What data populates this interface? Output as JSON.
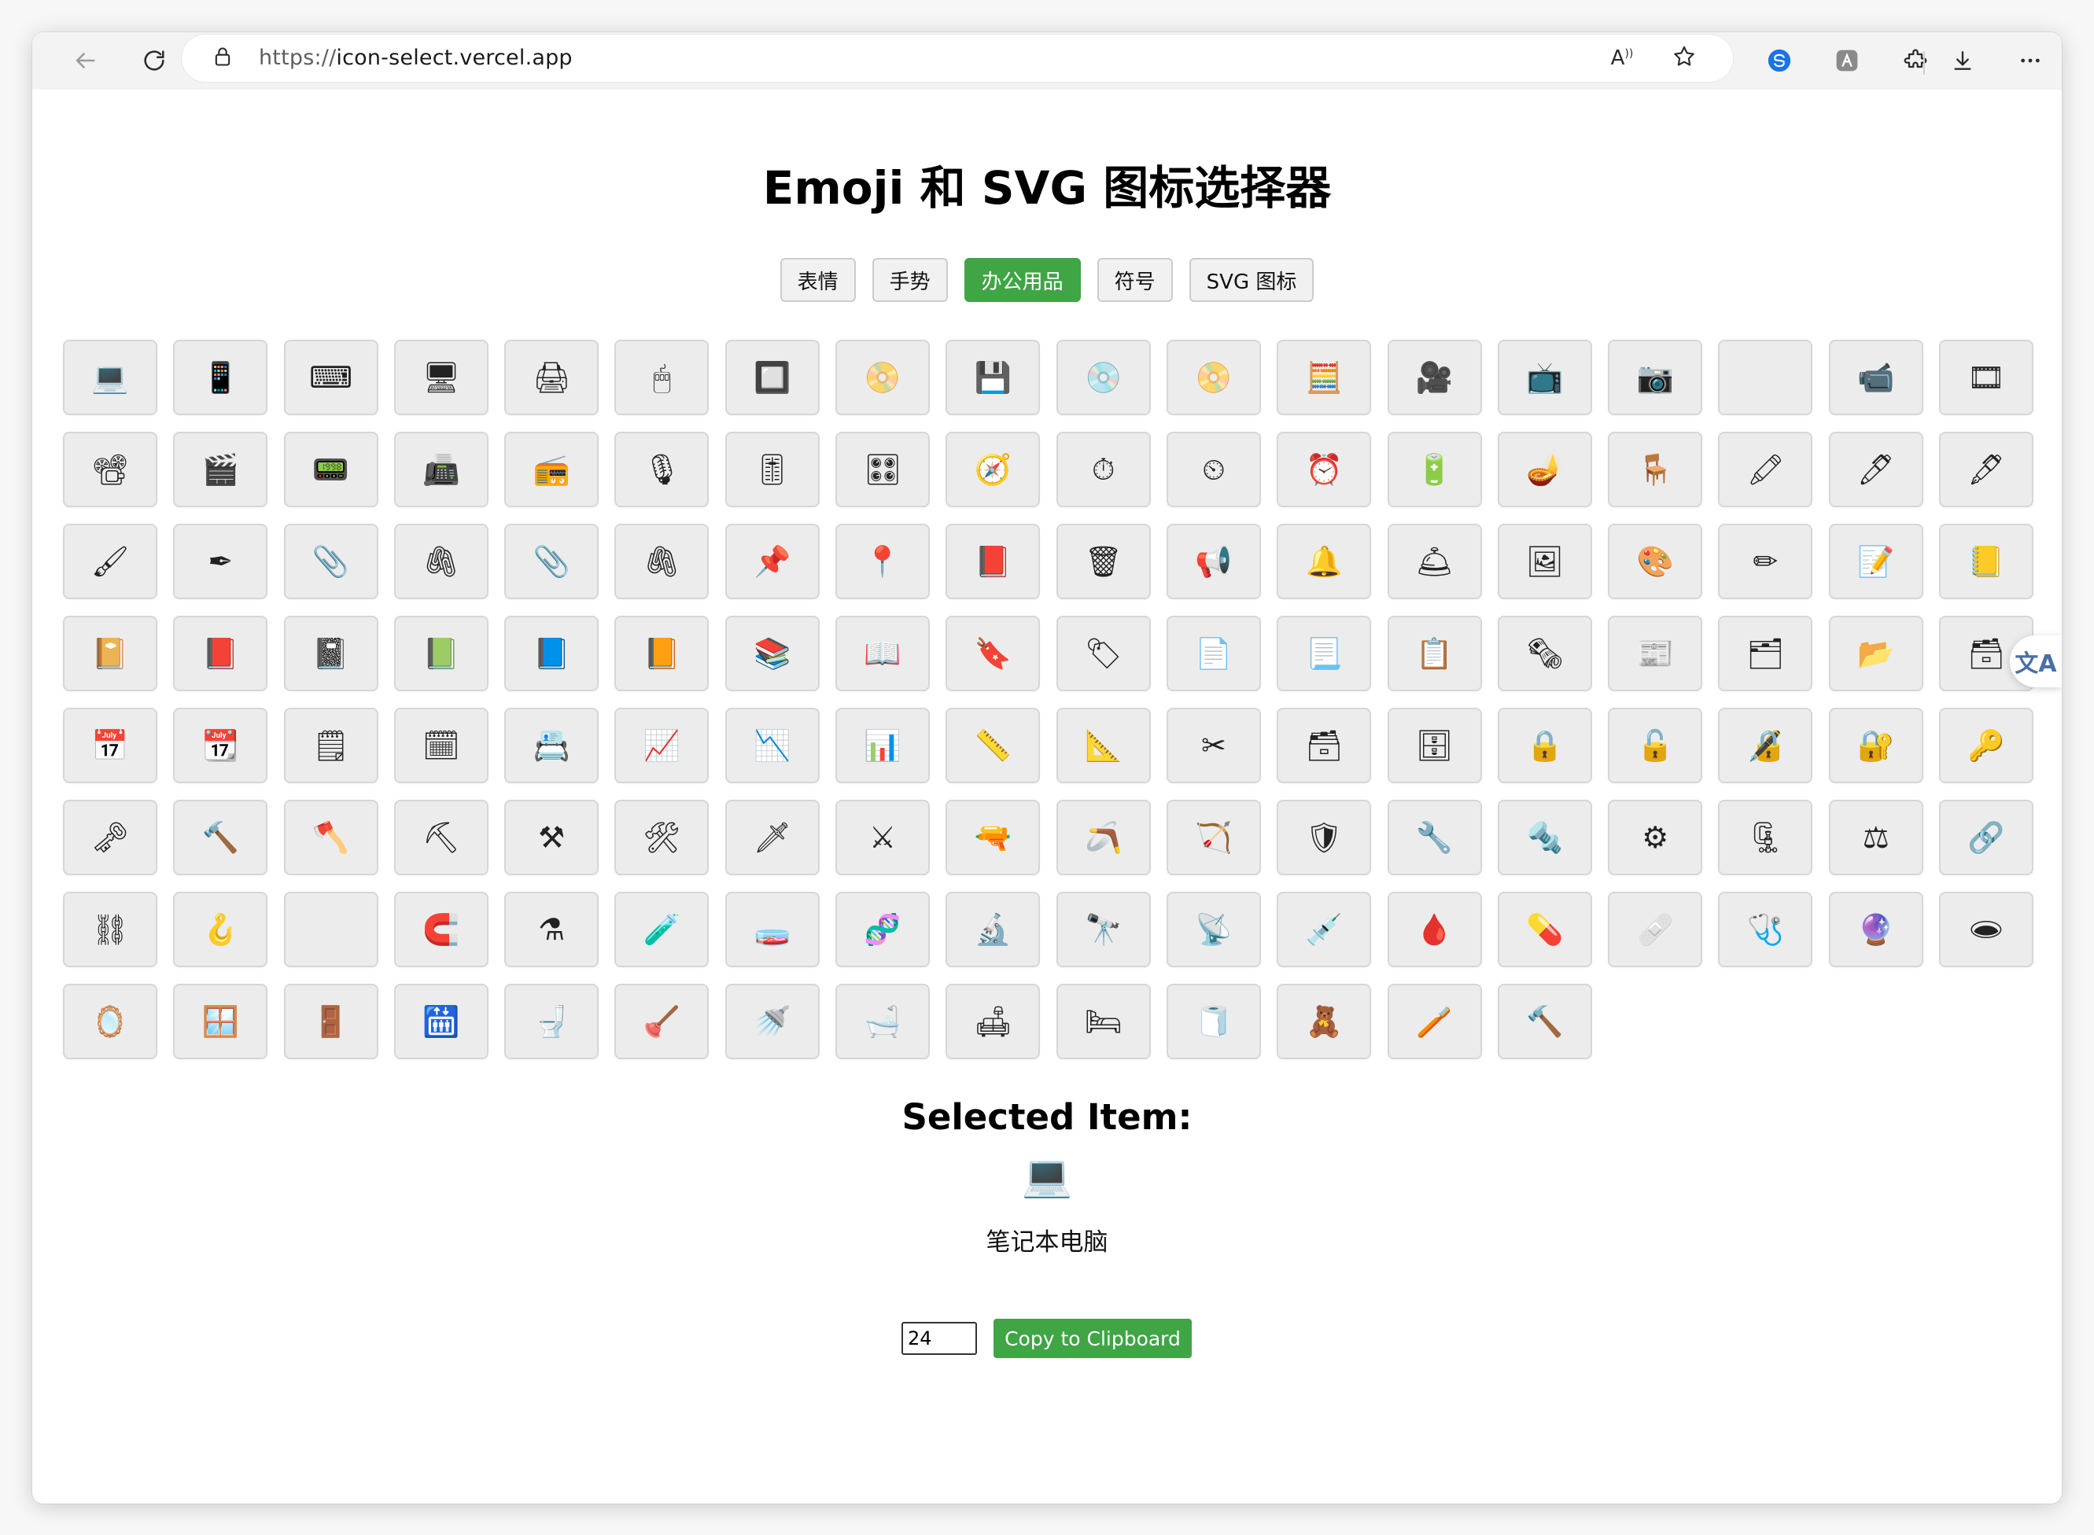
{
  "browser": {
    "url_scheme": "https://",
    "url_host": "icon-select.vercel.app",
    "icons": {
      "back": "arrow-left-icon",
      "reload": "reload-icon",
      "site_info": "lock-icon",
      "read_aloud": "read-aloud-icon",
      "favorite": "star-icon",
      "ext1": "extension-blue-icon",
      "ext2": "extension-gray-icon",
      "extensions": "puzzle-icon",
      "downloads": "download-icon",
      "menu": "more-icon"
    }
  },
  "page": {
    "title": "Emoji 和 SVG 图标选择器",
    "tabs": [
      {
        "label": "表情",
        "active": false
      },
      {
        "label": "手势",
        "active": false
      },
      {
        "label": "办公用品",
        "active": true
      },
      {
        "label": "符号",
        "active": false
      },
      {
        "label": "SVG 图标",
        "active": false
      }
    ],
    "accent_color": "#3fa545",
    "icons": [
      "💻",
      "📱",
      "⌨",
      "🖥",
      "🖨",
      "🖱",
      "🔲",
      "📀",
      "💾",
      "💿",
      "📀",
      "🧮",
      "🎥",
      "📺",
      "📷",
      "",
      "📹",
      "🎞",
      "📽",
      "🎬",
      "📟",
      "📠",
      "📻",
      "🎙",
      "🎚",
      "🎛",
      "🧭",
      "⏱",
      "⏲",
      "⏰",
      "🔋",
      "🪔",
      "🪑",
      "🖍",
      "🖊",
      "🖋",
      "🖌",
      "✒",
      "📎",
      "🖇",
      "📎",
      "🖇",
      "📌",
      "📍",
      "📕",
      "🗑",
      "📢",
      "🔔",
      "🛎",
      "🖼",
      "🎨",
      "✏",
      "📝",
      "📒",
      "📔",
      "📕",
      "📓",
      "📗",
      "📘",
      "📙",
      "📚",
      "📖",
      "🔖",
      "🏷",
      "📄",
      "📃",
      "📋",
      "🗞",
      "📰",
      "🗂",
      "📂",
      "🗃",
      "📅",
      "📆",
      "🗒",
      "🗓",
      "📇",
      "📈",
      "📉",
      "📊",
      "📏",
      "📐",
      "✂",
      "🗃",
      "🗄",
      "🔒",
      "🔓",
      "🔏",
      "🔐",
      "🔑",
      "🗝",
      "🔨",
      "🪓",
      "⛏",
      "⚒",
      "🛠",
      "🗡",
      "⚔",
      "🔫",
      "🪃",
      "🏹",
      "🛡",
      "🔧",
      "🔩",
      "⚙",
      "🗜",
      "⚖",
      "🔗",
      "⛓",
      "🪝",
      "",
      "🧲",
      "⚗",
      "🧪",
      "🧫",
      "🧬",
      "🔬",
      "🔭",
      "📡",
      "💉",
      "🩸",
      "💊",
      "🩹",
      "🩺",
      "🔮",
      "🕳",
      "🪞",
      "🪟",
      "🚪",
      "🛗",
      "🚽",
      "🪠",
      "🚿",
      "🛁",
      "🛋",
      "🛏",
      "🧻",
      "🧸",
      "🪥",
      "🔨"
    ]
  },
  "selection": {
    "heading": "Selected Item:",
    "glyph": "💻",
    "name": "笔记本电脑"
  },
  "controls": {
    "size_value": "24",
    "copy_label": "Copy to Clipboard"
  },
  "translate_fab": {
    "glyph": "文A",
    "icon": "translate-icon"
  }
}
